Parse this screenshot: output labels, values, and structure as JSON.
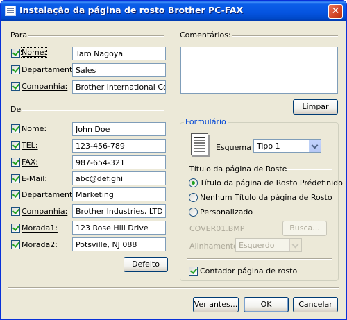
{
  "window": {
    "title": "Instalação da página de rosto Brother PC-FAX",
    "close_symbol": "✕"
  },
  "para": {
    "group_label": "Para",
    "fields": [
      {
        "label": "Nome:",
        "value": "Taro Nagoya",
        "checked": true
      },
      {
        "label": "Departamento:",
        "value": "Sales",
        "checked": true
      },
      {
        "label": "Companhia:",
        "value": "Brother International Corp",
        "checked": true
      }
    ]
  },
  "de": {
    "group_label": "De",
    "fields": [
      {
        "label": "Nome:",
        "value": "John Doe",
        "checked": true
      },
      {
        "label": "TEL:",
        "value": "123-456-789",
        "checked": true
      },
      {
        "label": "FAX:",
        "value": "987-654-321",
        "checked": true
      },
      {
        "label": "E-Mail:",
        "value": "abc@def.ghi",
        "checked": true
      },
      {
        "label": "Departamento:",
        "value": "Marketing",
        "checked": true
      },
      {
        "label": "Companhia:",
        "value": "Brother Industries, LTD",
        "checked": true
      },
      {
        "label": "Morada1:",
        "value": "123 Rose Hill Drive",
        "checked": true
      },
      {
        "label": "Morada2:",
        "value": "Potsville, NJ 088",
        "checked": true
      }
    ],
    "default_button": "Defeito"
  },
  "comments": {
    "label": "Comentários:",
    "value": "",
    "clear_button": "Limpar"
  },
  "formulario": {
    "group_title": "Formulário",
    "scheme_label": "Esquema",
    "scheme_value": "Tipo 1",
    "title_section_label": "Título da página de Rosto",
    "radio_options": [
      {
        "label": "Título da página de Rosto Prédefinido",
        "selected": true
      },
      {
        "label": "Nenhum Título da página de Rosto",
        "selected": false
      },
      {
        "label": "Personalizado",
        "selected": false
      }
    ],
    "file_value": "COVER01.BMP",
    "browse_button": "Busca...",
    "alignment_label": "Alinhamento",
    "alignment_value": "Esquerdo",
    "counter_label": "Contador página de rosto",
    "counter_checked": true
  },
  "footer": {
    "preview_button": "Ver antes...",
    "ok_button": "OK",
    "cancel_button": "Cancelar"
  },
  "icons": {
    "app": "fax-app-icon",
    "document": "document-icon",
    "close": "close-icon"
  }
}
